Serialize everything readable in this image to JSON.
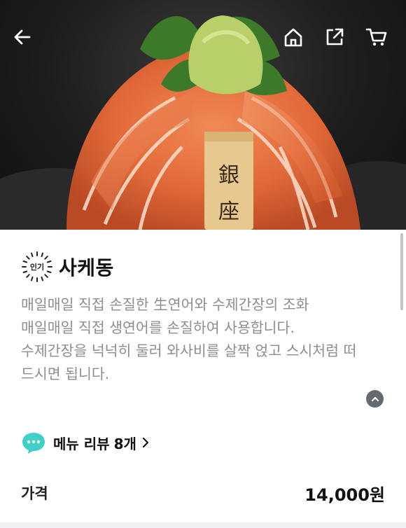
{
  "menu": {
    "badge": "인기",
    "title": "사케동",
    "description": [
      "매일매일 직접 손질한 生연어와 수제간장의 조화",
      "매일매일 직접 생연어를 손질하여 사용합니다.",
      "수제간장을 넉넉히 둘러 와사비를 살짝 얹고 스시처럼 떠",
      "드시면 됩니다."
    ]
  },
  "review": {
    "label": "메뉴 리뷰",
    "count": "8개"
  },
  "price": {
    "label": "가격",
    "value": "14,000원"
  },
  "hero": {
    "plate_text": [
      "銀",
      "座"
    ]
  },
  "icons": {
    "back": "arrow-left-icon",
    "home": "home-icon",
    "share": "share-icon",
    "cart": "cart-icon",
    "collapse": "chevron-up-icon",
    "review": "speech-bubble-icon",
    "review_chevron": "chevron-right-icon"
  },
  "colors": {
    "review_icon": "#3fd0c9",
    "collapse_button": "#646b71",
    "description_text": "#8e8e8e"
  }
}
